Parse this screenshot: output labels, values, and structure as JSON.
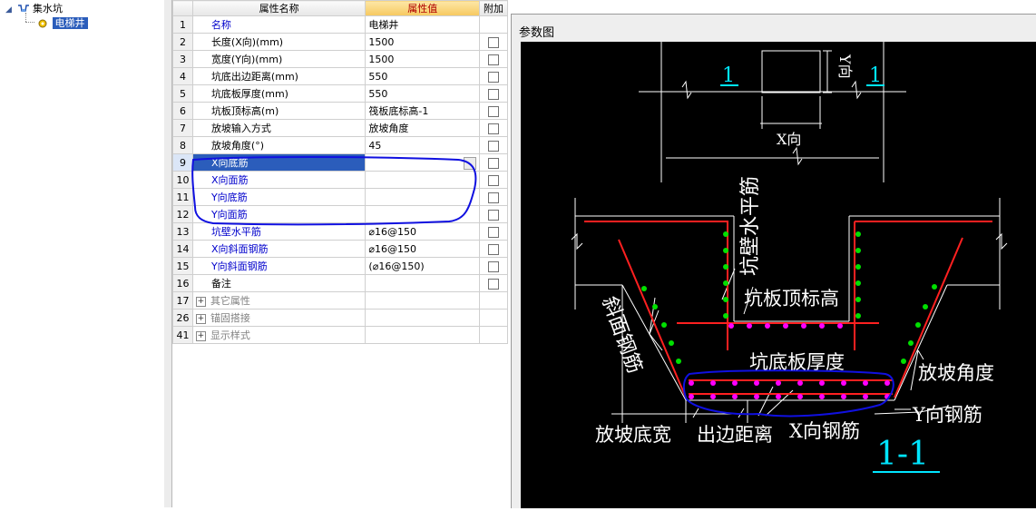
{
  "tree": {
    "root_label": "集水坑",
    "child_label": "电梯井"
  },
  "grid": {
    "headers": {
      "name": "属性名称",
      "value": "属性值",
      "extra": "附加"
    },
    "rows": [
      {
        "no": "1",
        "name": "名称",
        "value": "电梯井",
        "style": "blue",
        "check": false
      },
      {
        "no": "2",
        "name": "长度(X向)(mm)",
        "value": "1500",
        "style": "normal",
        "check": true
      },
      {
        "no": "3",
        "name": "宽度(Y向)(mm)",
        "value": "1500",
        "style": "normal",
        "check": true
      },
      {
        "no": "4",
        "name": "坑底出边距离(mm)",
        "value": "550",
        "style": "normal",
        "check": true
      },
      {
        "no": "5",
        "name": "坑底板厚度(mm)",
        "value": "550",
        "style": "normal",
        "check": true
      },
      {
        "no": "6",
        "name": "坑板顶标高(m)",
        "value": "筏板底标高-1",
        "style": "normal",
        "check": true
      },
      {
        "no": "7",
        "name": "放坡输入方式",
        "value": "放坡角度",
        "style": "normal",
        "check": true
      },
      {
        "no": "8",
        "name": "放坡角度(°)",
        "value": "45",
        "style": "normal",
        "check": true
      },
      {
        "no": "9",
        "name": "X向底筋",
        "value": "",
        "style": "selected",
        "check": true
      },
      {
        "no": "10",
        "name": "X向面筋",
        "value": "",
        "style": "blue",
        "check": true
      },
      {
        "no": "11",
        "name": "Y向底筋",
        "value": "",
        "style": "blue",
        "check": true
      },
      {
        "no": "12",
        "name": "Y向面筋",
        "value": "",
        "style": "blue",
        "check": true
      },
      {
        "no": "13",
        "name": "坑壁水平筋",
        "value": "⌀16@150",
        "style": "blue",
        "check": true
      },
      {
        "no": "14",
        "name": "X向斜面钢筋",
        "value": "⌀16@150",
        "style": "blue",
        "check": true
      },
      {
        "no": "15",
        "name": "Y向斜面钢筋",
        "value": "(⌀16@150)",
        "style": "blue",
        "check": true
      },
      {
        "no": "16",
        "name": "备注",
        "value": "",
        "style": "normal",
        "check": true
      },
      {
        "no": "17",
        "name": "其它属性",
        "value": "",
        "style": "group",
        "check": false
      },
      {
        "no": "26",
        "name": "锚固搭接",
        "value": "",
        "style": "group",
        "check": false
      },
      {
        "no": "41",
        "name": "显示样式",
        "value": "",
        "style": "group",
        "check": false
      }
    ]
  },
  "panel": {
    "title": "参数图",
    "diagram": {
      "plan_section_left": "1",
      "plan_section_right": "1",
      "y_dir": "Y向",
      "x_dir": "X向",
      "wall_rebar": "坑壁水平筋",
      "slab_top": "坑板顶标高",
      "slope_rebar": "斜面钢筋",
      "slab_thickness": "坑底板厚度",
      "slope_angle": "放坡角度",
      "y_rebar": "Y向钢筋",
      "slope_width": "放坡底宽",
      "edge_distance": "出边距离",
      "x_rebar": "X向钢筋",
      "section": "1-1"
    },
    "colors": {
      "background": "#000000",
      "line": "#ffffff",
      "rebar_red": "#ff2020",
      "dot_green": "#00e000",
      "dot_magenta": "#ff00ff",
      "label_cyan": "#00e5ff",
      "annotation_blue": "#1010e0"
    }
  }
}
